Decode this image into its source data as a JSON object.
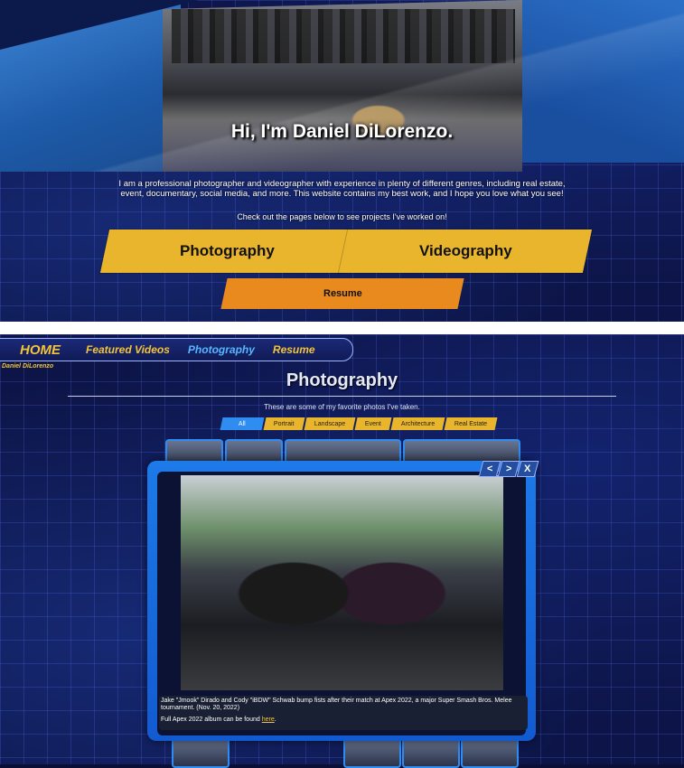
{
  "hero": {
    "title": "Hi, I'm Daniel DiLorenzo.",
    "intro": "I am a professional photographer and videographer with experience in plenty of different genres, including real estate, event, documentary, social media, and more. This website contains my best work, and I hope you love what you see!",
    "check_out": "Check out the pages below to see projects I've worked on!",
    "buttons": {
      "photography": "Photography",
      "videography": "Videography",
      "resume": "Resume"
    }
  },
  "nav": {
    "home": "HOME",
    "featured_videos": "Featured Videos",
    "photography": "Photography",
    "resume": "Resume",
    "site_name": "Daniel DiLorenzo"
  },
  "gallery": {
    "title": "Photography",
    "subtitle": "These are some of my favorite photos I've taken.",
    "filters": [
      "All",
      "Portrait",
      "Landscape",
      "Event",
      "Architecture",
      "Real Estate"
    ],
    "active_filter": "All"
  },
  "modal": {
    "controls": {
      "prev": "<",
      "next": ">",
      "close": "X"
    },
    "caption": "Jake \"Jmook\" Dirado and Cody \"iBDW\" Schwab bump fists after their match at Apex 2022, a major Super Smash Bros. Melee tournament. (Nov. 20, 2022)",
    "album_prefix": "Full Apex 2022 album can be found ",
    "album_link": "here",
    "album_suffix": "."
  },
  "colors": {
    "accent_yellow": "#e8b52c",
    "accent_orange": "#e98a1f",
    "accent_blue": "#2f8cf0",
    "background": "#0d1548"
  }
}
